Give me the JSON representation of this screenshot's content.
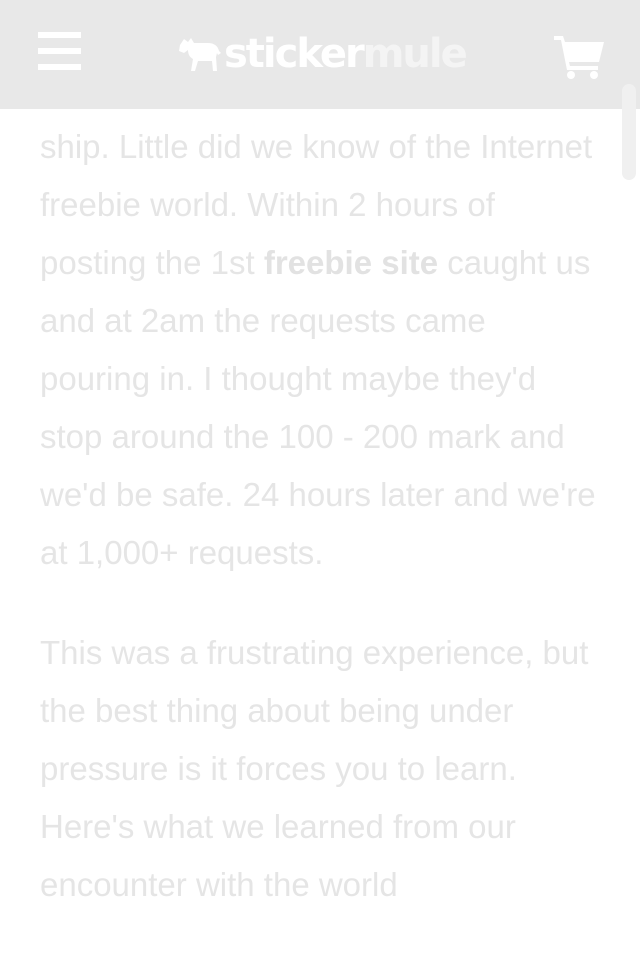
{
  "header": {
    "menu_icon": "hamburger-menu-icon",
    "logo": {
      "part1": "sticker",
      "part2": "mule",
      "icon": "mule-icon"
    },
    "cart_icon": "shopping-cart-icon"
  },
  "article": {
    "paragraph1": {
      "text_before_link": "ship. Little did we know of the Internet freebie world. Within 2 hours of posting the 1st ",
      "link_text": "freebie site",
      "text_after_link": " caught us and at 2am the requests came pouring in. I thought maybe they'd stop around the 100 - 200 mark and we'd be safe. 24 hours later and we're at 1,000+ requests."
    },
    "paragraph2": {
      "text": "This was a frustrating experience, but the best thing about being under pressure is it forces you to learn. Here's what we learned from our encounter with the world"
    }
  },
  "colors": {
    "header_bg": "#e8e8e8",
    "text": "#e5e5e5",
    "icon": "#ffffff"
  }
}
